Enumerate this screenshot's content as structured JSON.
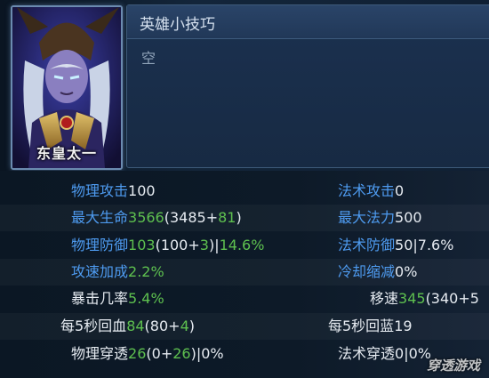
{
  "hero": {
    "name": "东皇太一"
  },
  "tips": {
    "title": "英雄小技巧",
    "body": "空"
  },
  "stats": {
    "physical_attack": {
      "label": "物理攻击",
      "value": "100"
    },
    "magic_attack": {
      "label": "法术攻击",
      "value": "0"
    },
    "max_hp": {
      "label": "最大生命",
      "total": "3566",
      "open": "(",
      "base": "3485",
      "plus": "+",
      "bonus": "81",
      "close": ")"
    },
    "max_mana": {
      "label": "最大法力",
      "value": "500"
    },
    "physical_defense": {
      "label": "物理防御",
      "total": "103",
      "open": "(",
      "base": "100",
      "plus": "+",
      "bonus": "3",
      "close": ")|",
      "pct": "14.6%"
    },
    "magic_defense": {
      "label": "法术防御",
      "value": "50|7.6%"
    },
    "attack_speed": {
      "label": "攻速加成",
      "value": "2.2%"
    },
    "cooldown": {
      "label": "冷却缩减",
      "value": "0%"
    },
    "crit_rate": {
      "label": "暴击几率",
      "value": "5.4%"
    },
    "move_speed": {
      "label": "移速",
      "total": "345",
      "rest": "(340+5"
    },
    "hp_regen": {
      "label": "每5秒回血",
      "total": "84",
      "open": "(",
      "base": "80",
      "plus": "+",
      "bonus": "4",
      "close": ")"
    },
    "mana_regen": {
      "label": "每5秒回蓝",
      "value": "19"
    },
    "armor_pen": {
      "label": "物理穿透",
      "total": "26",
      "open": "(",
      "base": "0",
      "plus": "+",
      "bonus": "26",
      "close": ")|0%"
    },
    "magic_pen": {
      "label": "法术穿透",
      "value": "0|0%"
    }
  },
  "watermark": "穿透游戏"
}
